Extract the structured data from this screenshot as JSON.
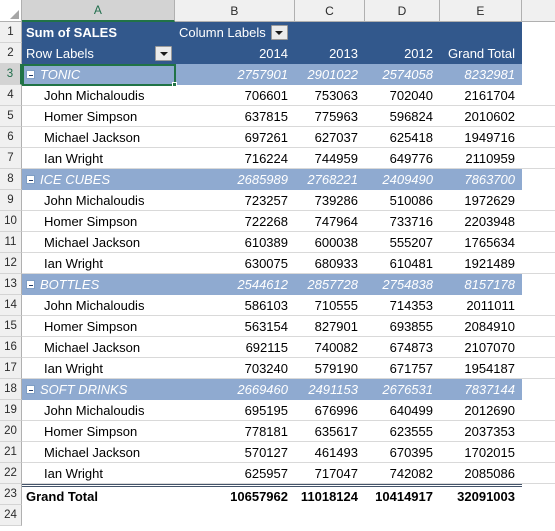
{
  "spreadsheet": {
    "column_headers": [
      "A",
      "B",
      "C",
      "D",
      "E"
    ],
    "selected_column": "A",
    "selected_cell": "A3",
    "row_numbers": [
      "1",
      "2",
      "3",
      "4",
      "5",
      "6",
      "7",
      "8",
      "9",
      "10",
      "11",
      "12",
      "13",
      "14",
      "15",
      "16",
      "17",
      "18",
      "19",
      "20",
      "21",
      "22",
      "23",
      "24"
    ],
    "colors": {
      "header_fill": "#32588c",
      "group_fill": "#8faad0",
      "selection": "#217346",
      "gutter": "#f0f0f0"
    }
  },
  "pivot": {
    "value_field_label": "Sum of SALES",
    "column_labels_label": "Column Labels",
    "row_labels_label": "Row Labels",
    "column_headers": [
      "2014",
      "2013",
      "2012",
      "Grand Total"
    ],
    "collapse_icon": "minus-icon",
    "filter_icon": "chevron-down-icon",
    "groups": [
      {
        "name": "TONIC",
        "totals": [
          "2757901",
          "2901022",
          "2574058",
          "8232981"
        ],
        "rows": [
          {
            "label": "John Michaloudis",
            "values": [
              "706601",
              "753063",
              "702040",
              "2161704"
            ]
          },
          {
            "label": "Homer Simpson",
            "values": [
              "637815",
              "775963",
              "596824",
              "2010602"
            ]
          },
          {
            "label": "Michael Jackson",
            "values": [
              "697261",
              "627037",
              "625418",
              "1949716"
            ]
          },
          {
            "label": "Ian Wright",
            "values": [
              "716224",
              "744959",
              "649776",
              "2110959"
            ]
          }
        ]
      },
      {
        "name": "ICE CUBES",
        "totals": [
          "2685989",
          "2768221",
          "2409490",
          "7863700"
        ],
        "rows": [
          {
            "label": "John Michaloudis",
            "values": [
              "723257",
              "739286",
              "510086",
              "1972629"
            ]
          },
          {
            "label": "Homer Simpson",
            "values": [
              "722268",
              "747964",
              "733716",
              "2203948"
            ]
          },
          {
            "label": "Michael Jackson",
            "values": [
              "610389",
              "600038",
              "555207",
              "1765634"
            ]
          },
          {
            "label": "Ian Wright",
            "values": [
              "630075",
              "680933",
              "610481",
              "1921489"
            ]
          }
        ]
      },
      {
        "name": "BOTTLES",
        "totals": [
          "2544612",
          "2857728",
          "2754838",
          "8157178"
        ],
        "rows": [
          {
            "label": "John Michaloudis",
            "values": [
              "586103",
              "710555",
              "714353",
              "2011011"
            ]
          },
          {
            "label": "Homer Simpson",
            "values": [
              "563154",
              "827901",
              "693855",
              "2084910"
            ]
          },
          {
            "label": "Michael Jackson",
            "values": [
              "692115",
              "740082",
              "674873",
              "2107070"
            ]
          },
          {
            "label": "Ian Wright",
            "values": [
              "703240",
              "579190",
              "671757",
              "1954187"
            ]
          }
        ]
      },
      {
        "name": "SOFT DRINKS",
        "totals": [
          "2669460",
          "2491153",
          "2676531",
          "7837144"
        ],
        "rows": [
          {
            "label": "John Michaloudis",
            "values": [
              "695195",
              "676996",
              "640499",
              "2012690"
            ]
          },
          {
            "label": "Homer Simpson",
            "values": [
              "778181",
              "635617",
              "623555",
              "2037353"
            ]
          },
          {
            "label": "Michael Jackson",
            "values": [
              "570127",
              "461493",
              "670395",
              "1702015"
            ]
          },
          {
            "label": "Ian Wright",
            "values": [
              "625957",
              "717047",
              "742082",
              "2085086"
            ]
          }
        ]
      }
    ],
    "grand_total": {
      "label": "Grand Total",
      "values": [
        "10657962",
        "11018124",
        "10414917",
        "32091003"
      ]
    }
  }
}
